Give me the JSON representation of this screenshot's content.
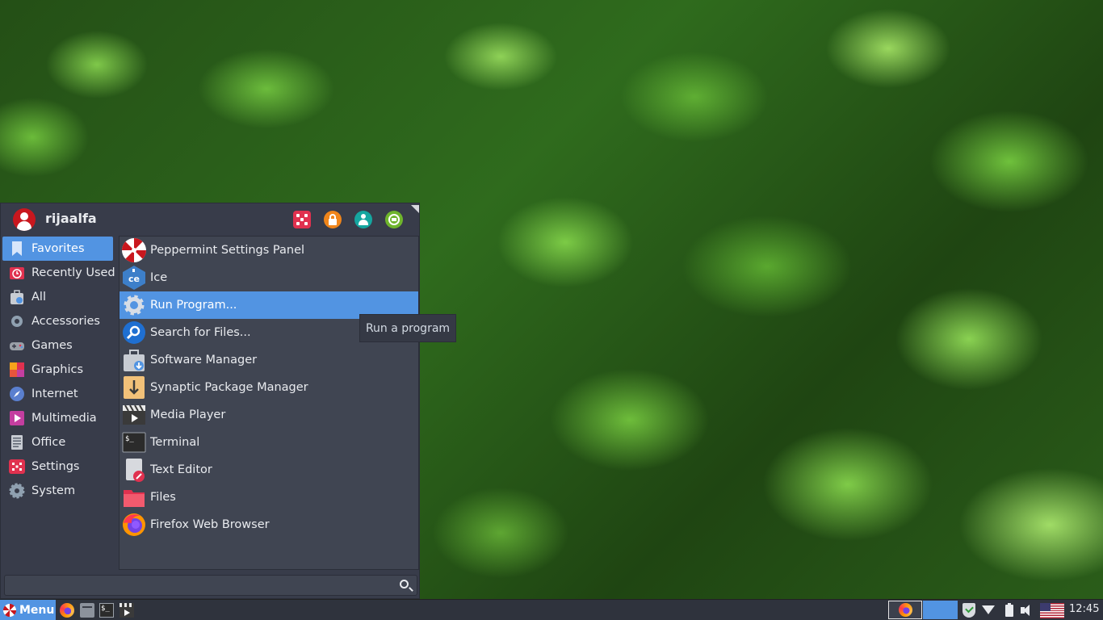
{
  "menu": {
    "username": "rijaalfa",
    "header_buttons": [
      {
        "name": "settings-icon",
        "color": "#e0314f"
      },
      {
        "name": "lock-icon",
        "color": "#f0851a"
      },
      {
        "name": "user-icon",
        "color": "#15a6a0"
      },
      {
        "name": "logout-icon",
        "color": "#6fb52c"
      }
    ],
    "categories": [
      {
        "label": "Favorites",
        "icon": "bookmark-icon",
        "active": true
      },
      {
        "label": "Recently Used",
        "icon": "recent-icon",
        "active": false
      },
      {
        "label": "All",
        "icon": "all-apps-icon",
        "active": false
      },
      {
        "label": "Accessories",
        "icon": "accessories-icon",
        "active": false
      },
      {
        "label": "Games",
        "icon": "gamepad-icon",
        "active": false
      },
      {
        "label": "Graphics",
        "icon": "graphics-icon",
        "active": false
      },
      {
        "label": "Internet",
        "icon": "internet-icon",
        "active": false
      },
      {
        "label": "Multimedia",
        "icon": "multimedia-icon",
        "active": false
      },
      {
        "label": "Office",
        "icon": "office-icon",
        "active": false
      },
      {
        "label": "Settings",
        "icon": "settings-icon",
        "active": false
      },
      {
        "label": "System",
        "icon": "system-icon",
        "active": false
      }
    ],
    "apps": [
      {
        "label": "Peppermint Settings Panel",
        "icon": "peppermint-icon",
        "active": false
      },
      {
        "label": "Ice",
        "icon": "ice-icon",
        "active": false
      },
      {
        "label": "Run Program...",
        "icon": "gear-icon",
        "active": true
      },
      {
        "label": "Search for Files...",
        "icon": "search-icon",
        "active": false
      },
      {
        "label": "Software Manager",
        "icon": "software-manager-icon",
        "active": false
      },
      {
        "label": "Synaptic Package Manager",
        "icon": "package-icon",
        "active": false
      },
      {
        "label": "Media Player",
        "icon": "media-player-icon",
        "active": false
      },
      {
        "label": "Terminal",
        "icon": "terminal-icon",
        "active": false
      },
      {
        "label": "Text Editor",
        "icon": "text-editor-icon",
        "active": false
      },
      {
        "label": "Files",
        "icon": "folder-icon",
        "active": false
      },
      {
        "label": "Firefox Web Browser",
        "icon": "firefox-icon",
        "active": false
      }
    ],
    "search_value": ""
  },
  "tooltip": {
    "text": "Run a program"
  },
  "taskbar": {
    "menu_label": "Menu",
    "clock": "12:45",
    "accent": "#5294e2"
  }
}
